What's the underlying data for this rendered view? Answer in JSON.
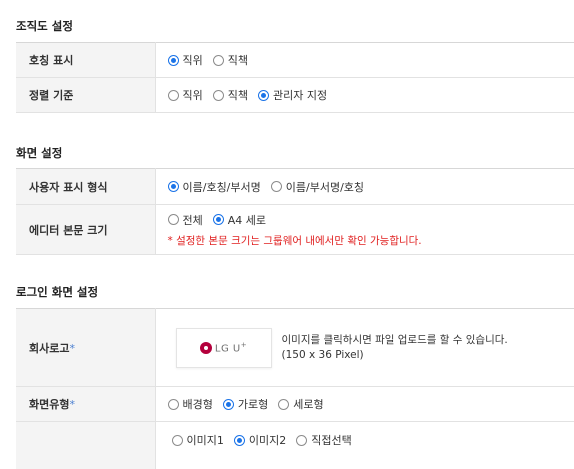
{
  "org_section": {
    "title": "조직도 설정",
    "rows": [
      {
        "label": "호칭 표시",
        "options": [
          "직위",
          "직책"
        ],
        "selected": 0
      },
      {
        "label": "정렬 기준",
        "options": [
          "직위",
          "직책",
          "관리자 지정"
        ],
        "selected": 2
      }
    ]
  },
  "screen_section": {
    "title": "화면 설정",
    "user_display": {
      "label": "사용자 표시 형식",
      "options": [
        "이름/호칭/부서명",
        "이름/부서명/호칭"
      ],
      "selected": 0
    },
    "editor_size": {
      "label": "에디터 본문 크기",
      "options": [
        "전체",
        "A4 세로"
      ],
      "selected": 1,
      "note": "* 설정한 본문 크기는 그룹웨어 내에서만 확인 가능합니다."
    }
  },
  "login_section": {
    "title": "로그인 화면 설정",
    "company_logo": {
      "label": "회사로고",
      "required_mark": "*",
      "logo_text": "LG U",
      "logo_sup": "+",
      "desc_line1": "이미지를 클릭하시면 파일 업로드를 할 수 있습니다.",
      "desc_line2": "(150 x 36 Pixel)"
    },
    "screen_type": {
      "label": "화면유형",
      "required_mark": "*",
      "options": [
        "배경형",
        "가로형",
        "세로형"
      ],
      "selected": 1
    },
    "image_row": {
      "label": "",
      "options": [
        "이미지1",
        "이미지2",
        "직접선택"
      ],
      "selected": 1
    }
  },
  "colors": {
    "accent": "#1a73e8",
    "warning": "#e02020",
    "label_bg": "#f4f4f4",
    "logo_brand": "#b4003c"
  }
}
